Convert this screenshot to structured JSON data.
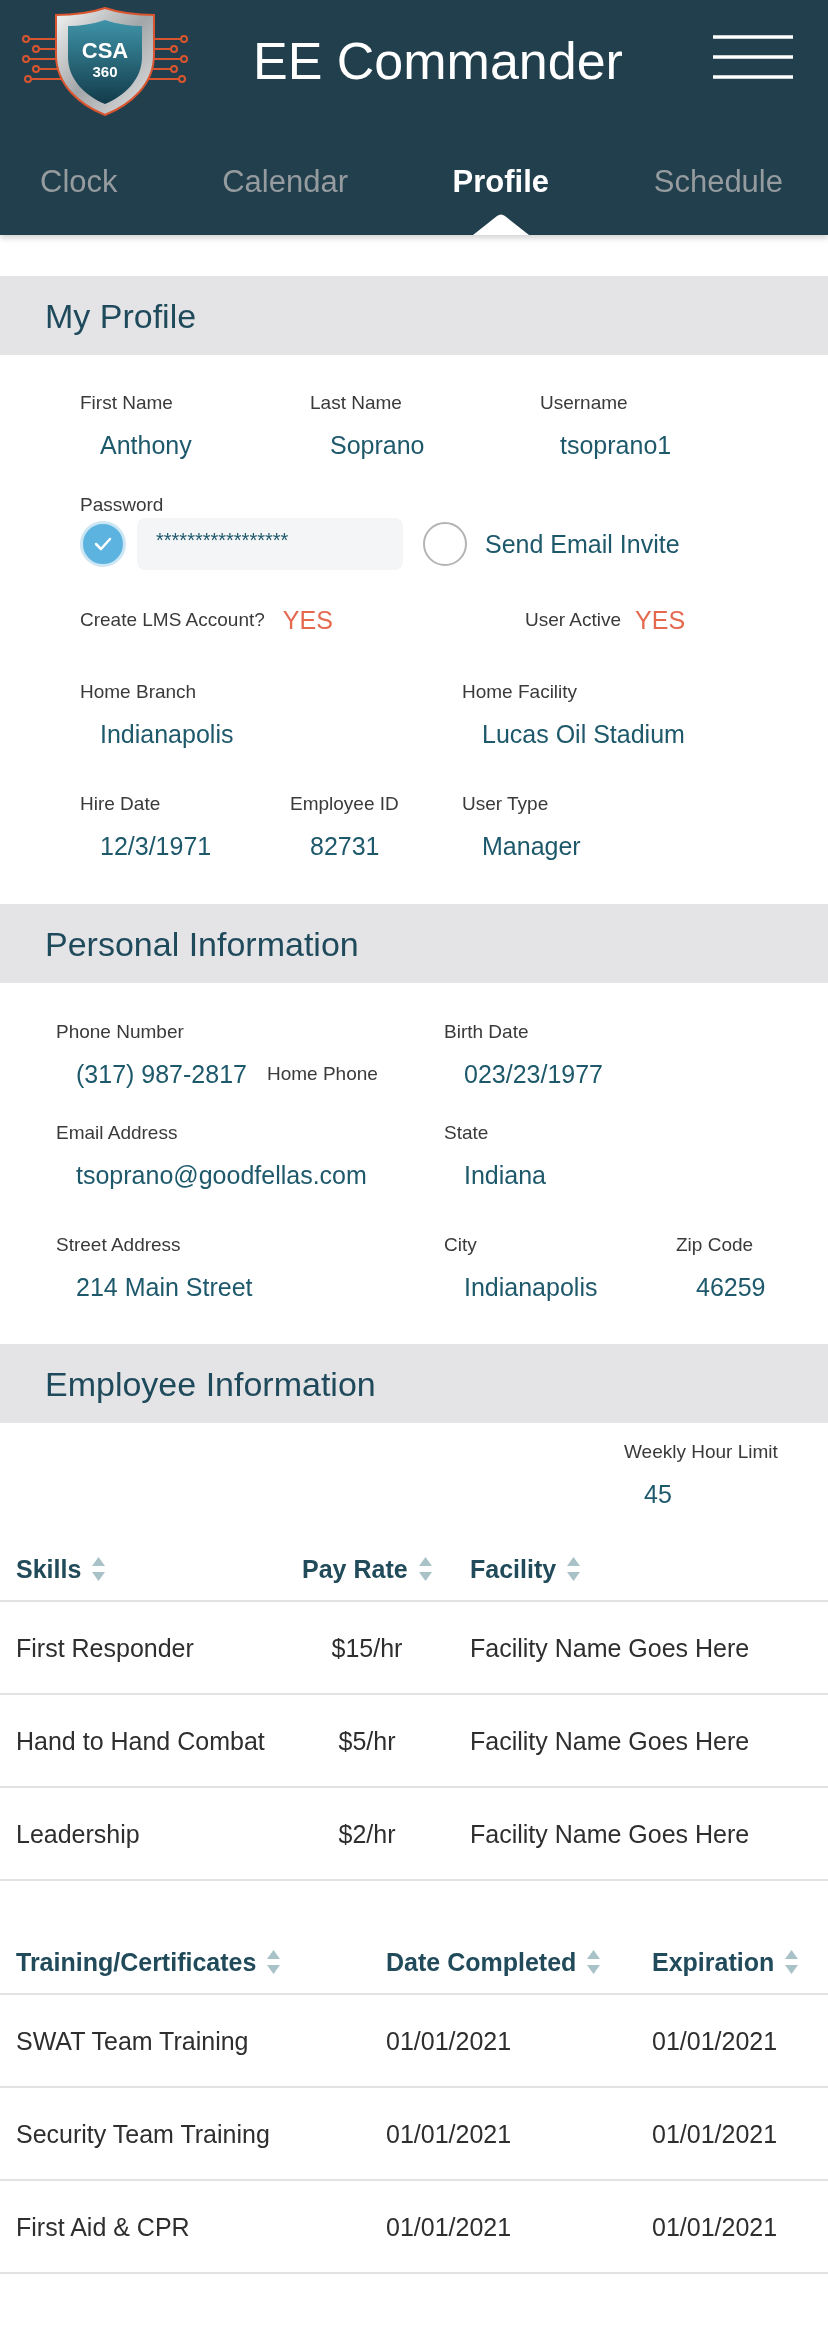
{
  "app_bar": {
    "logo_text": [
      "CSA",
      "360"
    ],
    "title": "EE Commander"
  },
  "tabs": [
    {
      "label": "Clock",
      "selected": false
    },
    {
      "label": "Calendar",
      "selected": false
    },
    {
      "label": "Profile",
      "selected": true
    },
    {
      "label": "Schedule",
      "selected": false
    }
  ],
  "my_profile": {
    "title": "My Profile",
    "first_name": {
      "label": "First Name",
      "value": "Anthony"
    },
    "last_name": {
      "label": "Last Name",
      "value": "Soprano"
    },
    "username": {
      "label": "Username",
      "value": "tsoprano1"
    },
    "password": {
      "label": "Password",
      "checked": true,
      "value": "*****************"
    },
    "send_email_invite": {
      "label": "Send Email Invite",
      "checked": false
    },
    "create_lms_account": {
      "label": "Create LMS Account?",
      "value": "YES"
    },
    "user_active": {
      "label": "User Active",
      "value": "YES"
    },
    "home_branch": {
      "label": "Home Branch",
      "value": "Indianapolis"
    },
    "home_facility": {
      "label": "Home Facility",
      "value": "Lucas Oil Stadium"
    },
    "hire_date": {
      "label": "Hire Date",
      "value": "12/3/1971"
    },
    "employee_id": {
      "label": "Employee ID",
      "value": "82731"
    },
    "user_type": {
      "label": "User Type",
      "value": "Manager"
    }
  },
  "personal_information": {
    "title": "Personal Information",
    "phone_number": {
      "label": "Phone Number",
      "value": "(317) 987-2817",
      "phone_type": "Home Phone"
    },
    "birth_date": {
      "label": "Birth Date",
      "value": "023/23/1977"
    },
    "email_address": {
      "label": "Email Address",
      "value": "tsoprano@goodfellas.com"
    },
    "state": {
      "label": "State",
      "value": "Indiana"
    },
    "street_address": {
      "label": "Street Address",
      "value": "214 Main Street"
    },
    "city": {
      "label": "City",
      "value": "Indianapolis"
    },
    "zip_code": {
      "label": "Zip Code",
      "value": "46259"
    }
  },
  "employee_information": {
    "title": "Employee Information",
    "weekly_hour_limit": {
      "label": "Weekly Hour Limit",
      "value": "45"
    },
    "skills_table": {
      "columns": [
        "Skills",
        "Pay Rate",
        "Facility"
      ],
      "rows": [
        [
          "First Responder",
          "$15/hr",
          "Facility Name Goes Here"
        ],
        [
          "Hand to Hand Combat",
          "$5/hr",
          "Facility Name Goes Here"
        ],
        [
          "Leadership",
          "$2/hr",
          "Facility Name Goes Here"
        ]
      ]
    },
    "training_table": {
      "columns": [
        "Training/Certificates",
        "Date Completed",
        "Expiration"
      ],
      "rows": [
        [
          "SWAT Team Training",
          "01/01/2021",
          "01/01/2021"
        ],
        [
          "Security Team Training",
          "01/01/2021",
          "01/01/2021"
        ],
        [
          "First Aid & CPR",
          "01/01/2021",
          "01/01/2021"
        ]
      ]
    }
  }
}
